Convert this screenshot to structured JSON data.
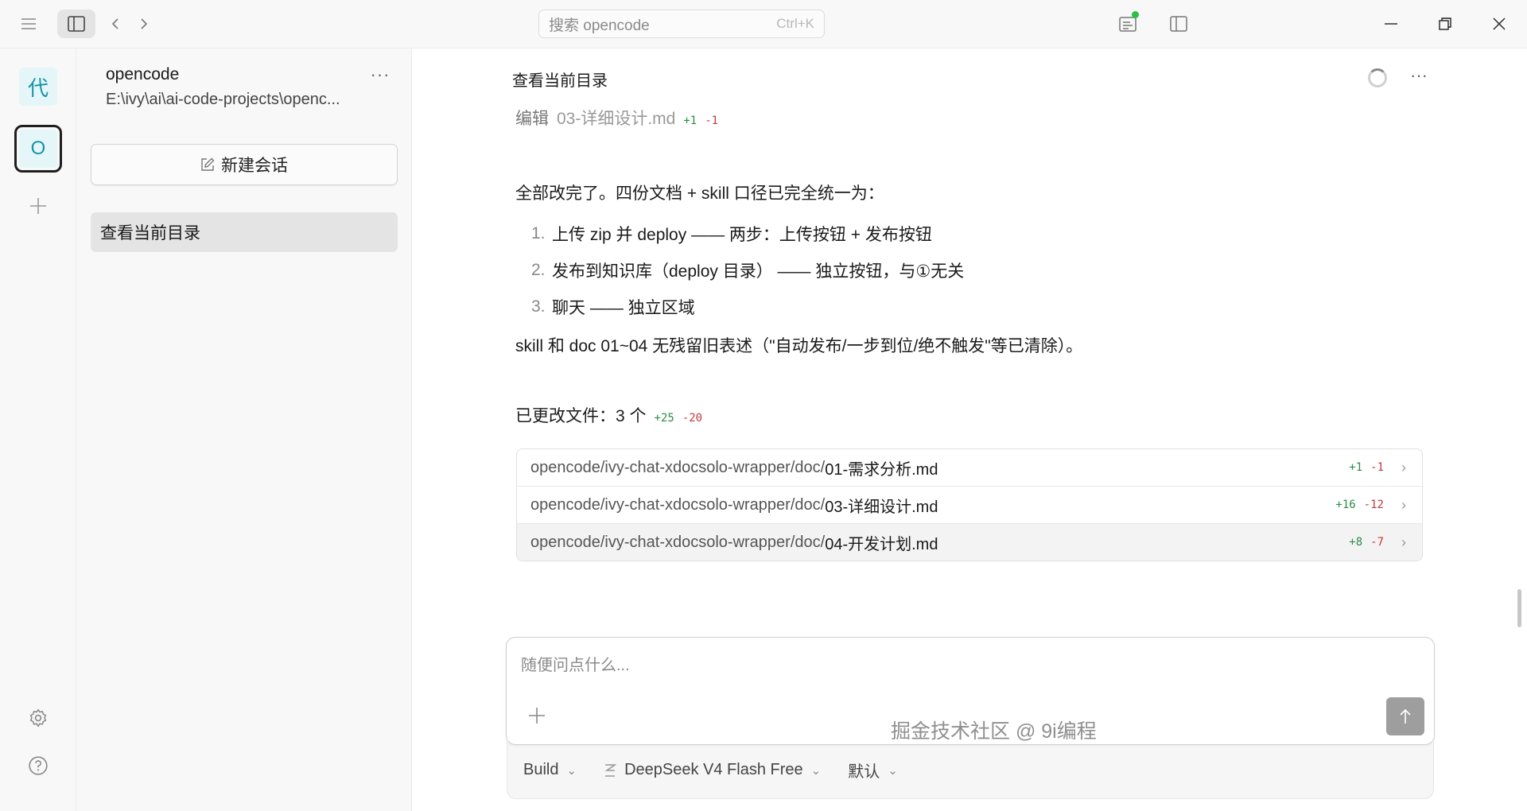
{
  "topbar": {
    "search_placeholder": "搜索 opencode",
    "search_shortcut": "Ctrl+K"
  },
  "rail": {
    "projects": [
      {
        "label": "代"
      },
      {
        "label": "O"
      }
    ]
  },
  "sidebar": {
    "project_name": "opencode",
    "project_path": "E:\\ivy\\ai\\ai-code-projects\\openc...",
    "more": "···",
    "new_session_label": "新建会话",
    "sessions": [
      {
        "label": "查看当前目录"
      }
    ]
  },
  "conversation": {
    "title": "查看当前目录",
    "more": "···",
    "edit_event": {
      "verb": "编辑",
      "file": "03-详细设计.md",
      "added": "+1",
      "removed": "-1"
    },
    "intro": "全部改完了。四份文档 + skill 口径已完全统一为：",
    "list": [
      {
        "num": "1.",
        "text": "上传 zip 并 deploy —— 两步：上传按钮 + 发布按钮"
      },
      {
        "num": "2.",
        "text": "发布到知识库（deploy 目录） —— 独立按钮，与①无关"
      },
      {
        "num": "3.",
        "text": "聊天 —— 独立区域"
      }
    ],
    "skill_note": "skill 和 doc 01~04 无残留旧表述（\"自动发布/一步到位/绝不触发\"等已清除）。",
    "changed_files_label": "已更改文件：3 个",
    "changed_added": "+25",
    "changed_removed": "-20",
    "files": [
      {
        "dir": "opencode/ivy-chat-xdocsolo-wrapper/doc/",
        "name": "01-需求分析.md",
        "added": "+1",
        "removed": "-1"
      },
      {
        "dir": "opencode/ivy-chat-xdocsolo-wrapper/doc/",
        "name": "03-详细设计.md",
        "added": "+16",
        "removed": "-12"
      },
      {
        "dir": "opencode/ivy-chat-xdocsolo-wrapper/doc/",
        "name": "04-开发计划.md",
        "added": "+8",
        "removed": "-7"
      }
    ]
  },
  "composer": {
    "placeholder": "随便问点什么...",
    "agent": "Build",
    "model": "DeepSeek V4 Flash Free",
    "variant": "默认"
  },
  "watermark": "掘金技术社区 @ 9i编程",
  "colors": {
    "accent_teal": "#1594a8",
    "added_green": "#2c8c4a",
    "removed_red": "#c23b3b",
    "status_green": "#2bbf43"
  }
}
